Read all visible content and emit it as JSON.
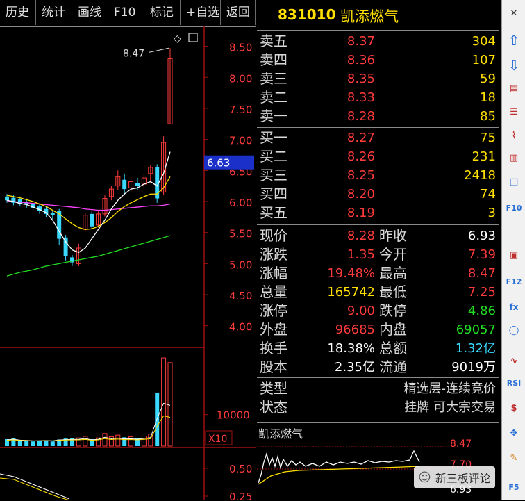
{
  "tabs": [
    {
      "label": "历史",
      "width": 52
    },
    {
      "label": "统计",
      "width": 52
    },
    {
      "label": "画线",
      "width": 52
    },
    {
      "label": "F10",
      "width": 52
    },
    {
      "label": "标记",
      "width": 52
    },
    {
      "label": "+自选",
      "width": 58
    },
    {
      "label": "返回",
      "width": 50
    }
  ],
  "stock": {
    "code": "831010",
    "name": "凯添燃气"
  },
  "asks": [
    {
      "label": "卖五",
      "price": "8.37",
      "volume": "304"
    },
    {
      "label": "卖四",
      "price": "8.36",
      "volume": "107"
    },
    {
      "label": "卖三",
      "price": "8.35",
      "volume": "59"
    },
    {
      "label": "卖二",
      "price": "8.33",
      "volume": "18"
    },
    {
      "label": "卖一",
      "price": "8.28",
      "volume": "85"
    }
  ],
  "bids": [
    {
      "label": "买一",
      "price": "8.27",
      "volume": "75"
    },
    {
      "label": "买二",
      "price": "8.26",
      "volume": "231"
    },
    {
      "label": "买三",
      "price": "8.25",
      "volume": "2418"
    },
    {
      "label": "买四",
      "price": "8.20",
      "volume": "74"
    },
    {
      "label": "买五",
      "price": "8.19",
      "volume": "3"
    }
  ],
  "stats": [
    {
      "l1": "现价",
      "v1": "8.28",
      "c1": "#ff3b3b",
      "l2": "昨收",
      "v2": "6.93",
      "c2": "#ffffff"
    },
    {
      "l1": "涨跌",
      "v1": "1.35",
      "c1": "#ff3b3b",
      "l2": "今开",
      "v2": "7.39",
      "c2": "#ff3b3b"
    },
    {
      "l1": "涨幅",
      "v1": "19.48%",
      "c1": "#ff3b3b",
      "l2": "最高",
      "v2": "8.47",
      "c2": "#ff3b3b"
    },
    {
      "l1": "总量",
      "v1": "165742",
      "c1": "#ffe000",
      "l2": "最低",
      "v2": "7.25",
      "c2": "#ff3b3b"
    },
    {
      "l1": "涨停",
      "v1": "9.00",
      "c1": "#ff3b3b",
      "l2": "跌停",
      "v2": "4.86",
      "c2": "#22dd22"
    },
    {
      "l1": "外盘",
      "v1": "96685",
      "c1": "#ff3b3b",
      "l2": "内盘",
      "v2": "69057",
      "c2": "#22dd22"
    },
    {
      "l1": "换手",
      "v1": "18.38%",
      "c1": "#ffffff",
      "l2": "总额",
      "v2": "1.32亿",
      "c2": "#3ad7ff"
    },
    {
      "l1": "股本",
      "v1": "2.35亿",
      "c1": "#ffffff",
      "l2": "流通",
      "v2": "9019万",
      "c2": "#ffffff"
    }
  ],
  "info": [
    {
      "label": "类型",
      "value": "精选层-连续竞价"
    },
    {
      "label": "状态",
      "value": "挂牌  可大宗交易"
    }
  ],
  "mini_chart": {
    "name": "凯添燃气",
    "high": "8.47",
    "mid": "7.70",
    "low": "6.93"
  },
  "chart_data": {
    "type": "candlestick",
    "price_ticks": [
      "8.50",
      "8.00",
      "7.50",
      "7.00",
      "6.50",
      "6.00",
      "5.50",
      "5.00",
      "4.50",
      "4.00"
    ],
    "price_range": [
      3.65,
      8.82
    ],
    "current_price_label": "6.63",
    "high_label": "8.47",
    "volume_tick": "10000",
    "volume_scale_label": "X10",
    "indicator_ticks": [
      "0.50",
      "0.25"
    ],
    "candles": [
      {
        "o": 6.08,
        "c": 6.02,
        "h": 6.12,
        "l": 5.98
      },
      {
        "o": 6.06,
        "c": 5.98,
        "h": 6.1,
        "l": 5.94
      },
      {
        "o": 6.04,
        "c": 5.96,
        "h": 6.08,
        "l": 5.92
      },
      {
        "o": 6.0,
        "c": 5.95,
        "h": 6.05,
        "l": 5.9
      },
      {
        "o": 5.96,
        "c": 5.9,
        "h": 6.0,
        "l": 5.86
      },
      {
        "o": 5.92,
        "c": 5.85,
        "h": 5.96,
        "l": 5.8
      },
      {
        "o": 5.88,
        "c": 5.8,
        "h": 5.92,
        "l": 5.75
      },
      {
        "o": 5.82,
        "c": 5.78,
        "h": 5.86,
        "l": 5.72
      },
      {
        "o": 5.85,
        "c": 5.4,
        "h": 5.88,
        "l": 5.3
      },
      {
        "o": 5.42,
        "c": 5.12,
        "h": 5.46,
        "l": 5.05
      },
      {
        "o": 5.1,
        "c": 5.02,
        "h": 5.14,
        "l": 4.96
      },
      {
        "o": 5.0,
        "c": 5.25,
        "h": 5.32,
        "l": 4.96
      },
      {
        "o": 5.55,
        "c": 5.78,
        "h": 5.82,
        "l": 5.52
      },
      {
        "o": 5.8,
        "c": 5.6,
        "h": 5.84,
        "l": 5.56
      },
      {
        "o": 5.62,
        "c": 5.8,
        "h": 5.84,
        "l": 5.58
      },
      {
        "o": 5.8,
        "c": 6.05,
        "h": 6.1,
        "l": 5.76
      },
      {
        "o": 6.08,
        "c": 6.2,
        "h": 6.25,
        "l": 6.02
      },
      {
        "o": 6.25,
        "c": 6.4,
        "h": 6.5,
        "l": 6.18
      },
      {
        "o": 6.35,
        "c": 6.2,
        "h": 6.45,
        "l": 6.1
      },
      {
        "o": 6.22,
        "c": 6.32,
        "h": 6.4,
        "l": 6.15
      },
      {
        "o": 6.3,
        "c": 6.25,
        "h": 6.38,
        "l": 6.18
      },
      {
        "o": 6.28,
        "c": 6.38,
        "h": 6.44,
        "l": 6.22
      },
      {
        "o": 6.45,
        "c": 6.55,
        "h": 6.58,
        "l": 6.3
      },
      {
        "o": 6.55,
        "c": 6.05,
        "h": 6.6,
        "l": 5.98
      },
      {
        "o": 6.15,
        "c": 6.95,
        "h": 7.05,
        "l": 6.1
      },
      {
        "o": 7.25,
        "c": 8.3,
        "h": 8.47,
        "l": 7.25
      }
    ],
    "volumes": [
      220,
      260,
      200,
      180,
      150,
      160,
      170,
      150,
      210,
      240,
      250,
      260,
      310,
      220,
      260,
      400,
      300,
      350,
      280,
      300,
      260,
      320,
      380,
      1700,
      2800,
      2650
    ],
    "ma_short": [
      6.02,
      6.0,
      5.97,
      5.95,
      5.91,
      5.87,
      5.82,
      5.7,
      5.52,
      5.35,
      5.22,
      5.18,
      5.25,
      5.4,
      5.55,
      5.7,
      5.88,
      6.02,
      6.12,
      6.2,
      6.22,
      6.28,
      6.32,
      6.25,
      6.45,
      6.8
    ],
    "ma_mid": [
      6.1,
      6.08,
      6.06,
      6.03,
      6.0,
      5.96,
      5.92,
      5.86,
      5.8,
      5.72,
      5.64,
      5.58,
      5.55,
      5.56,
      5.6,
      5.66,
      5.74,
      5.84,
      5.92,
      5.98,
      6.03,
      6.08,
      6.12,
      6.12,
      6.22,
      6.4
    ],
    "ma_long": [
      6.0,
      6.0,
      5.99,
      5.98,
      5.97,
      5.96,
      5.95,
      5.94,
      5.93,
      5.92,
      5.91,
      5.9,
      5.88,
      5.87,
      5.86,
      5.86,
      5.87,
      5.88,
      5.89,
      5.9,
      5.91,
      5.92,
      5.93,
      5.93,
      5.94,
      5.96
    ],
    "ma_year": [
      4.8,
      4.83,
      4.86,
      4.88,
      4.9,
      4.93,
      4.96,
      4.98,
      5.0,
      5.02,
      5.04,
      5.06,
      5.08,
      5.1,
      5.12,
      5.15,
      5.18,
      5.21,
      5.24,
      5.27,
      5.3,
      5.33,
      5.36,
      5.39,
      5.42,
      5.45
    ]
  },
  "colors": {
    "up": "#ff3b3b",
    "down": "#3ad7ff",
    "ma_short": "#ffffff",
    "ma_mid": "#ffe000",
    "ma_long": "#ff44ff",
    "ma_year": "#22dd22",
    "axis": "#a01010"
  }
}
